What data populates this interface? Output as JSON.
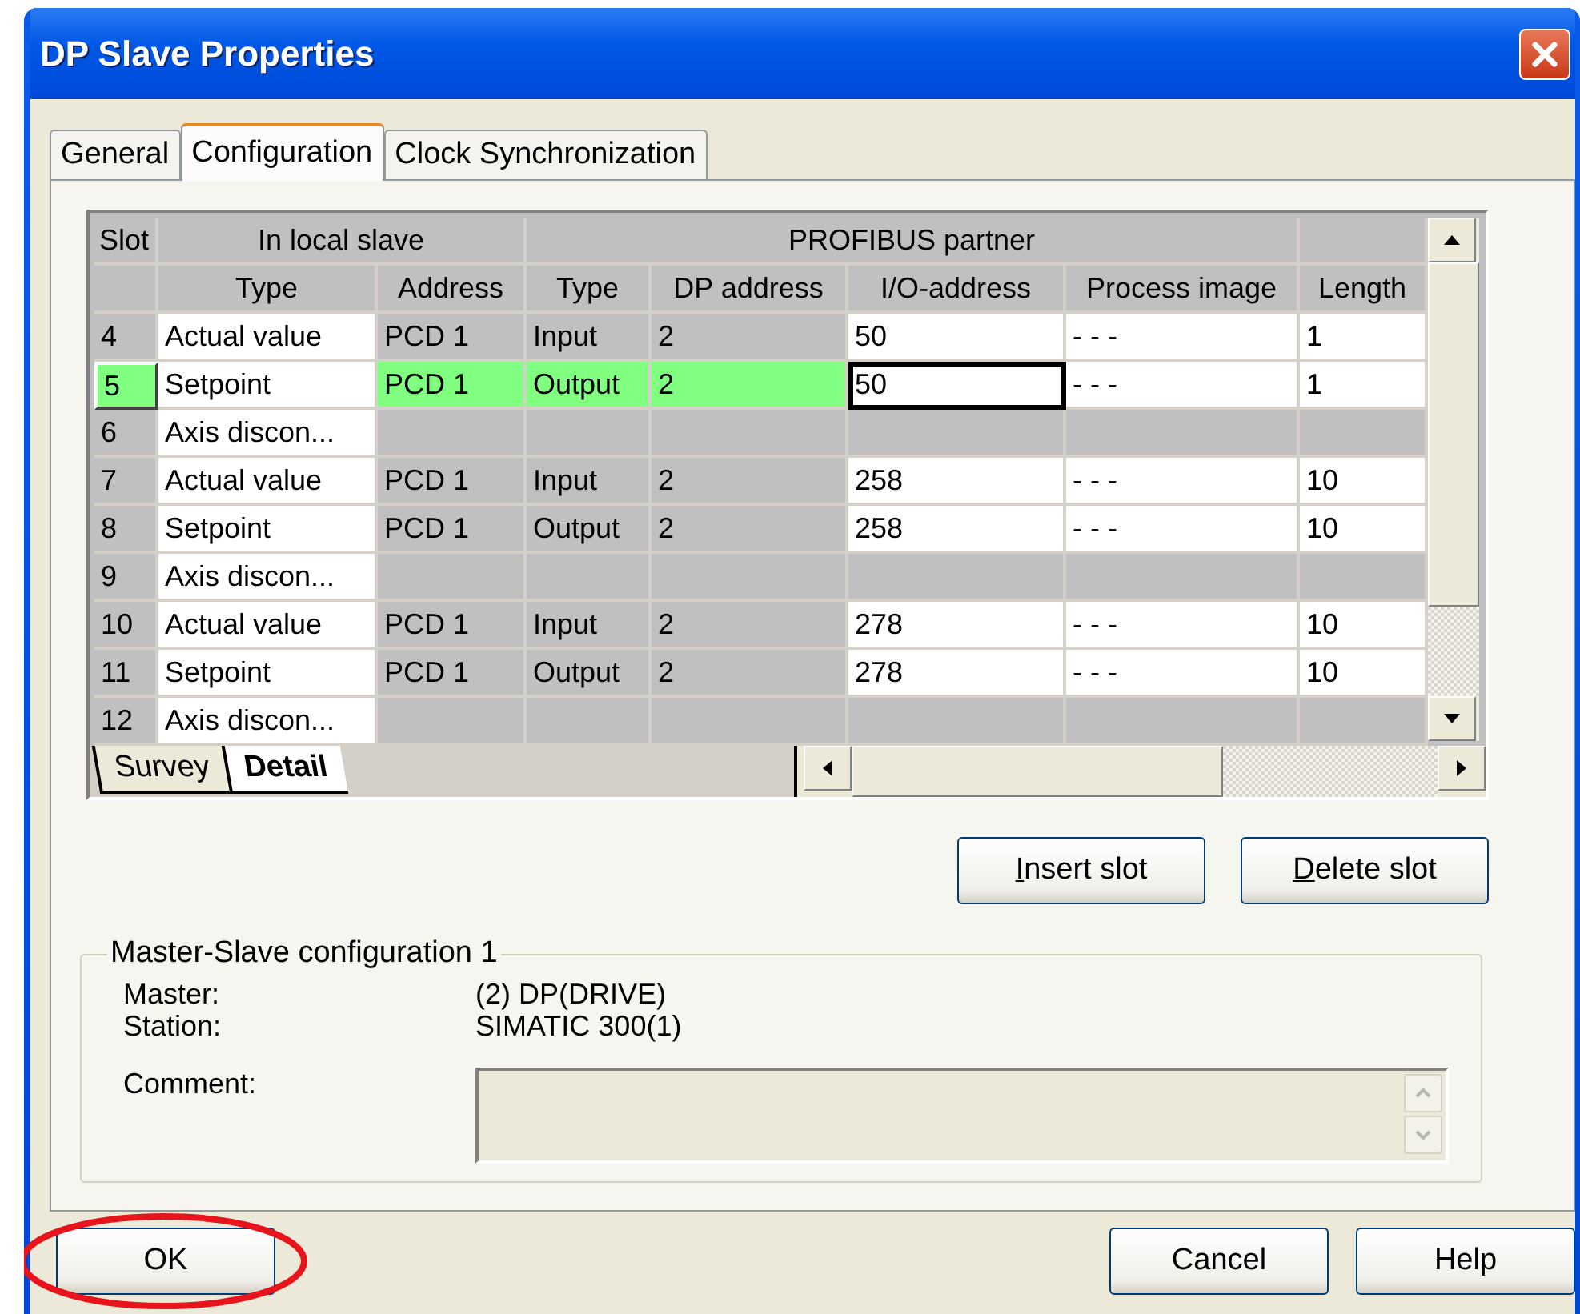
{
  "window": {
    "title": "DP Slave Properties"
  },
  "tabs": [
    {
      "label": "General",
      "selected": false
    },
    {
      "label": "Configuration",
      "selected": true
    },
    {
      "label": "Clock Synchronization",
      "selected": false
    }
  ],
  "table": {
    "group_headers": [
      "Slot",
      "In local slave",
      "PROFIBUS partner"
    ],
    "columns": [
      "Type",
      "Address",
      "Type",
      "DP address",
      "I/O-address",
      "Process image",
      "Length"
    ],
    "rows": [
      {
        "kind": "module",
        "selected": false,
        "slot": "4",
        "type": "Actual value",
        "address": "PCD 1",
        "partner_type": "Input",
        "dp_address": "2",
        "io_address": "50",
        "process_image": "- - -",
        "length": "1"
      },
      {
        "kind": "module",
        "selected": true,
        "slot": "5",
        "type": "Setpoint",
        "address": "PCD 1",
        "partner_type": "Output",
        "dp_address": "2",
        "io_address": "50",
        "process_image": "- - -",
        "length": "1"
      },
      {
        "kind": "placeholder",
        "selected": false,
        "slot": "6",
        "type": "Axis discon..."
      },
      {
        "kind": "module",
        "selected": false,
        "slot": "7",
        "type": "Actual value",
        "address": "PCD 1",
        "partner_type": "Input",
        "dp_address": "2",
        "io_address": "258",
        "process_image": "- - -",
        "length": "10"
      },
      {
        "kind": "module",
        "selected": false,
        "slot": "8",
        "type": "Setpoint",
        "address": "PCD 1",
        "partner_type": "Output",
        "dp_address": "2",
        "io_address": "258",
        "process_image": "- - -",
        "length": "10"
      },
      {
        "kind": "placeholder",
        "selected": false,
        "slot": "9",
        "type": "Axis discon..."
      },
      {
        "kind": "module",
        "selected": false,
        "slot": "10",
        "type": "Actual value",
        "address": "PCD 1",
        "partner_type": "Input",
        "dp_address": "2",
        "io_address": "278",
        "process_image": "- - -",
        "length": "10"
      },
      {
        "kind": "module",
        "selected": false,
        "slot": "11",
        "type": "Setpoint",
        "address": "PCD 1",
        "partner_type": "Output",
        "dp_address": "2",
        "io_address": "278",
        "process_image": "- - -",
        "length": "10"
      },
      {
        "kind": "placeholder",
        "selected": false,
        "slot": "12",
        "type": "Axis discon..."
      }
    ]
  },
  "sheet_tabs": [
    {
      "label": "Survey",
      "selected": false
    },
    {
      "label": "Detail",
      "selected": true
    }
  ],
  "slot_buttons": [
    {
      "label": "Insert slot",
      "mnemonic": true
    },
    {
      "label": "Delete slot",
      "mnemonic": true
    }
  ],
  "master_slave": {
    "title": "Master-Slave configuration 1",
    "fields": [
      {
        "label": "Master:",
        "value": "(2) DP(DRIVE)"
      },
      {
        "label": "Station:",
        "value": "SIMATIC 300(1)"
      }
    ],
    "comment_label": "Comment:",
    "comment_disabled": true
  },
  "buttons": [
    {
      "label": "OK",
      "highlighted": true
    },
    {
      "label": "Cancel",
      "highlighted": false
    },
    {
      "label": "Help",
      "highlighted": false
    }
  ]
}
